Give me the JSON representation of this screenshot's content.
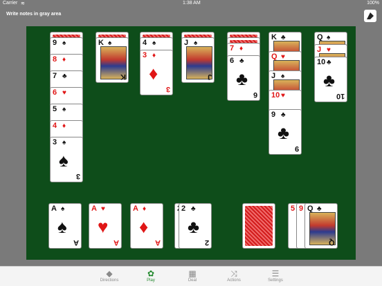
{
  "status": {
    "carrier": "Carrier",
    "wifi_icon": "wifi-icon",
    "time": "1:38 AM",
    "battery": "100%"
  },
  "notes_label": "Write notes in gray area",
  "toolbar": {
    "items": [
      {
        "label": "Directions",
        "icon": "directions-icon"
      },
      {
        "label": "Play",
        "icon": "play-icon",
        "active": true
      },
      {
        "label": "Deal",
        "icon": "deal-icon"
      },
      {
        "label": "Actions",
        "icon": "shuffle-icon"
      },
      {
        "label": "Settings",
        "icon": "settings-icon"
      }
    ]
  },
  "colors": {
    "table": "#0e4d1a",
    "background": "#7a7a7a",
    "active": "#23892e"
  },
  "tableau": [
    {
      "down": 1,
      "up": [
        [
          "9",
          "♠"
        ],
        [
          "8",
          "♦"
        ],
        [
          "7",
          "♣"
        ],
        [
          "6",
          "♥"
        ],
        [
          "5",
          "♠"
        ],
        [
          "4",
          "♦"
        ],
        [
          "3",
          "♠"
        ]
      ]
    },
    {
      "down": 1,
      "up": [
        [
          "K",
          "♠"
        ]
      ]
    },
    {
      "down": 1,
      "up": [
        [
          "4",
          "♠"
        ],
        [
          "3",
          "♦"
        ]
      ]
    },
    {
      "down": 1,
      "up": [
        [
          "J",
          "♠"
        ]
      ]
    },
    {
      "down": 2,
      "up": [
        [
          "7",
          "♦"
        ],
        [
          "6",
          "♣"
        ]
      ]
    },
    {
      "down": 0,
      "up": [
        [
          "K",
          "♣"
        ],
        [
          "Q",
          "♥"
        ],
        [
          "J",
          "♠"
        ],
        [
          "10",
          "♥"
        ],
        [
          "9",
          "♣"
        ]
      ]
    },
    {
      "down": 0,
      "up": [
        [
          "Q",
          "♠"
        ],
        [
          "J",
          "♥"
        ],
        [
          "10",
          "♣"
        ]
      ]
    }
  ],
  "foundations": [
    [
      [
        "A",
        "♠"
      ]
    ],
    [
      [
        "A",
        "♥"
      ]
    ],
    [
      [
        "A",
        "♦"
      ]
    ],
    [
      [
        "2",
        "♣"
      ],
      [
        "2",
        "♣"
      ]
    ]
  ],
  "stock": "face-down",
  "waste": [
    [
      "5",
      "♦"
    ],
    [
      "9",
      "♥"
    ],
    [
      "Q",
      "♣"
    ]
  ]
}
